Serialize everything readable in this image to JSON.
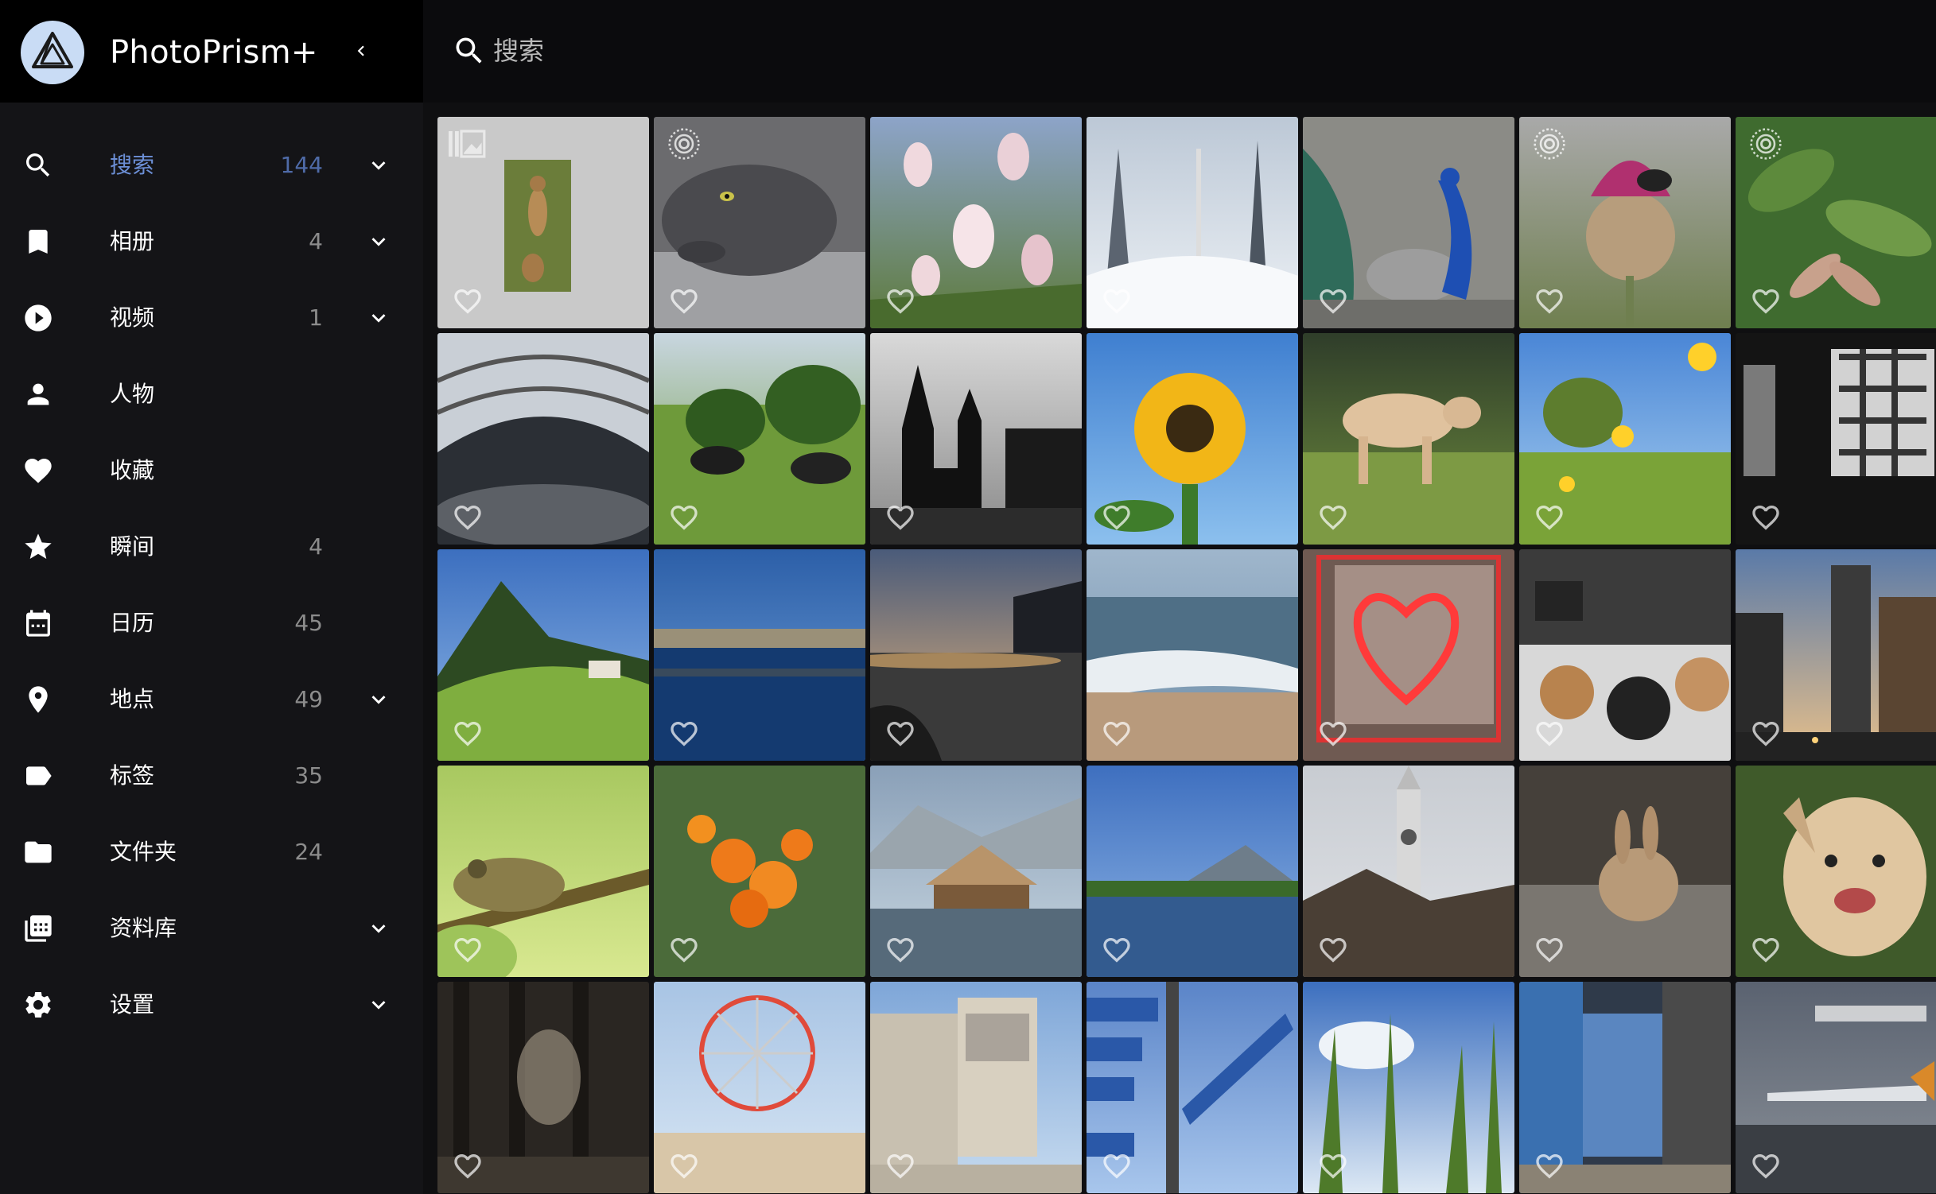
{
  "app": {
    "title": "PhotoPrism+"
  },
  "search": {
    "placeholder": "搜索"
  },
  "colors": {
    "accent": "#6c8fd6",
    "sidebar_bg": "#141417",
    "topbar_bg": "#0b0b0d"
  },
  "sidebar": {
    "items": [
      {
        "label": "搜索",
        "count": "144",
        "icon": "search-icon",
        "expandable": true,
        "active": true
      },
      {
        "label": "相册",
        "count": "4",
        "icon": "bookmark-icon",
        "expandable": true
      },
      {
        "label": "视频",
        "count": "1",
        "icon": "play-circle-icon",
        "expandable": true
      },
      {
        "label": "人物",
        "count": "",
        "icon": "person-icon",
        "expandable": false
      },
      {
        "label": "收藏",
        "count": "",
        "icon": "heart-icon",
        "expandable": false
      },
      {
        "label": "瞬间",
        "count": "4",
        "icon": "star-icon",
        "expandable": false
      },
      {
        "label": "日历",
        "count": "45",
        "icon": "calendar-icon",
        "expandable": false
      },
      {
        "label": "地点",
        "count": "49",
        "icon": "map-pin-icon",
        "expandable": true
      },
      {
        "label": "标签",
        "count": "35",
        "icon": "label-tag-icon",
        "expandable": false
      },
      {
        "label": "文件夹",
        "count": "24",
        "icon": "folder-icon",
        "expandable": false
      },
      {
        "label": "资料库",
        "count": "",
        "icon": "library-icon",
        "expandable": true
      },
      {
        "label": "设置",
        "count": "",
        "icon": "gear-icon",
        "expandable": true
      }
    ]
  },
  "photos": [
    {
      "subject": "meerkat",
      "type_badge": "stack-icon"
    },
    {
      "subject": "grey cat",
      "type_badge": "live-icon"
    },
    {
      "subject": "magnolia blossoms"
    },
    {
      "subject": "snowy forest"
    },
    {
      "subject": "peacock"
    },
    {
      "subject": "thistle with bumblebee",
      "type_badge": "live-icon"
    },
    {
      "subject": "maple seeds",
      "type_badge": "live-icon"
    },
    {
      "subject": "glass dome interior"
    },
    {
      "subject": "grazing cattle"
    },
    {
      "subject": "castle silhouette"
    },
    {
      "subject": "sunflower"
    },
    {
      "subject": "cow in field"
    },
    {
      "subject": "yellow flower meadow"
    },
    {
      "subject": "dark building windows"
    },
    {
      "subject": "alpine meadow"
    },
    {
      "subject": "lake reflection"
    },
    {
      "subject": "sunset lake"
    },
    {
      "subject": "sea shore"
    },
    {
      "subject": "neon sign"
    },
    {
      "subject": "bakery counter"
    },
    {
      "subject": "city street dusk"
    },
    {
      "subject": "chameleon"
    },
    {
      "subject": "orange flowers"
    },
    {
      "subject": "lake pavilion"
    },
    {
      "subject": "mountain lake"
    },
    {
      "subject": "clock tower"
    },
    {
      "subject": "rabbit"
    },
    {
      "subject": "smiling dog"
    },
    {
      "subject": "under the pier"
    },
    {
      "subject": "ferris wheel beach"
    },
    {
      "subject": "modern museum"
    },
    {
      "subject": "signpost"
    },
    {
      "subject": "grass against sky"
    },
    {
      "subject": "blue alley"
    },
    {
      "subject": "rainy window airplane"
    }
  ]
}
